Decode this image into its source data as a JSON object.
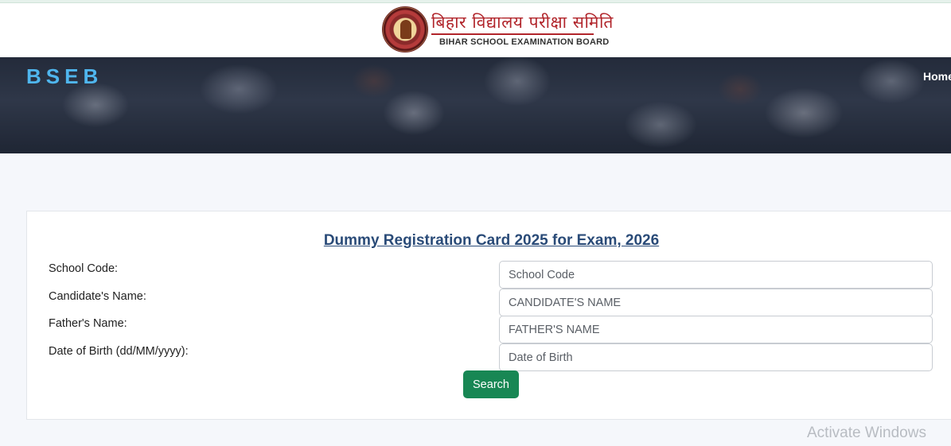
{
  "header": {
    "logo_hindi": "बिहार विद्यालय परीक्षा समिति",
    "logo_english": "BIHAR SCHOOL EXAMINATION BOARD"
  },
  "hero": {
    "brand": "BSEB",
    "nav": {
      "home": "Home"
    }
  },
  "form": {
    "title": "Dummy Registration Card 2025 for Exam, 2026",
    "fields": [
      {
        "label": "School Code:",
        "placeholder": "School Code",
        "value": ""
      },
      {
        "label": "Candidate's Name:",
        "placeholder": "CANDIDATE'S NAME",
        "value": ""
      },
      {
        "label": "Father's Name:",
        "placeholder": "FATHER'S NAME",
        "value": ""
      },
      {
        "label": "Date of Birth (dd/MM/yyyy):",
        "placeholder": "Date of Birth",
        "value": ""
      }
    ],
    "search_label": "Search"
  },
  "overlay": {
    "watermark": "Activate Windows"
  },
  "colors": {
    "brand_blue": "#4fb6ee",
    "title_blue": "#2a4b78",
    "button_green": "#188754",
    "logo_red": "#b1252b"
  }
}
